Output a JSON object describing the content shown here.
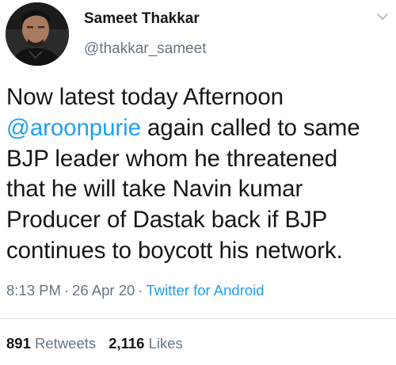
{
  "user": {
    "display_name": "Sameet Thakkar",
    "handle": "@thakkar_sameet",
    "avatar_icon": "profile-photo"
  },
  "menu_icon": "chevron-down-icon",
  "tweet": {
    "lines": [
      {
        "pre": "Now latest today Afternoon",
        "mention": "",
        "post": ""
      },
      {
        "pre": "",
        "mention": "@aroonpurie",
        "post": " again called to same"
      },
      {
        "pre": "BJP leader whom he threatened",
        "mention": "",
        "post": ""
      },
      {
        "pre": "that he will take Navin kumar",
        "mention": "",
        "post": ""
      },
      {
        "pre": "Producer of Dastak back if BJP",
        "mention": "",
        "post": ""
      },
      {
        "pre": "continues to boycott his network.",
        "mention": "",
        "post": ""
      }
    ]
  },
  "meta": {
    "time": "8:13 PM",
    "separator": "·",
    "date": "26 Apr 20",
    "source": "Twitter for Android"
  },
  "stats": {
    "retweets_count": "891",
    "retweets_label": "Retweets",
    "likes_count": "2,116",
    "likes_label": "Likes"
  },
  "colors": {
    "accent": "#1da1f2",
    "text": "#14171a",
    "muted": "#657786"
  }
}
